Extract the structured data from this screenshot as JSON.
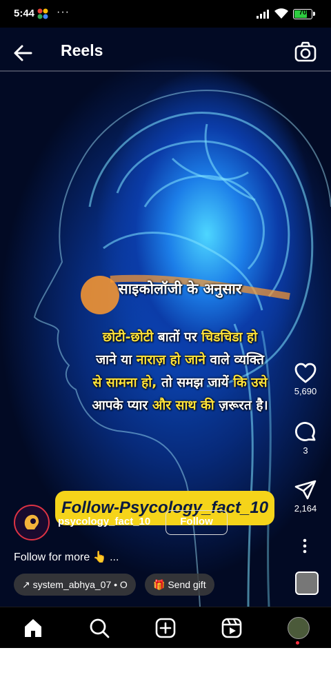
{
  "status_bar": {
    "time": "5:44",
    "dots": "···",
    "battery": "70"
  },
  "header": {
    "title": "Reels"
  },
  "overlay": {
    "heading": "साइकोलॉजी के अनुसार",
    "lines": [
      [
        {
          "text": "छोटी-छोटी",
          "hl": true
        },
        {
          "text": " बातों पर ",
          "hl": false
        },
        {
          "text": "चिडचिडा हो",
          "hl": true
        }
      ],
      [
        {
          "text": "जाने या ",
          "hl": false
        },
        {
          "text": "नाराज़ हो जाने",
          "hl": true
        },
        {
          "text": " वाले व्यक्ति",
          "hl": false
        }
      ],
      [
        {
          "text": "से सामना हो,",
          "hl": true
        },
        {
          "text": " तो समझ जायें ",
          "hl": false
        },
        {
          "text": "कि उसे",
          "hl": true
        }
      ],
      [
        {
          "text": "आपके प्यार ",
          "hl": false
        },
        {
          "text": "और साथ की",
          "hl": true
        },
        {
          "text": " ज़रूरत है।",
          "hl": false
        }
      ]
    ]
  },
  "banner": {
    "text": "Follow-Psycology_fact_10"
  },
  "author": {
    "username": "psycology_fact_10",
    "follow_label": "Follow"
  },
  "caption": {
    "text": "Follow for more 👆 ..."
  },
  "chips": {
    "audio": "system_abhya_07 • O",
    "gift": "Send gift"
  },
  "actions": {
    "likes": "5,690",
    "comments": "3",
    "shares": "2,164"
  },
  "icons": {
    "back": "arrow-left-icon",
    "camera": "camera-icon",
    "like": "heart-icon",
    "comment": "comment-icon",
    "share": "send-icon",
    "more": "more-vertical-icon",
    "home": "home-icon",
    "search": "search-icon",
    "create": "plus-square-icon",
    "reels": "reels-icon"
  },
  "colors": {
    "highlight": "#ffe23a",
    "banner_bg": "#f5d41a",
    "battery": "#2ecc40",
    "notification_dot": "#ff3040"
  }
}
